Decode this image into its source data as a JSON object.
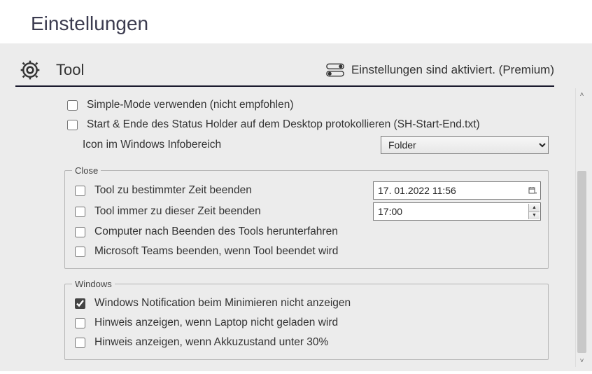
{
  "page_title": "Einstellungen",
  "section": "Tool",
  "premium_status": "Einstellungen sind aktiviert. (Premium)",
  "top": {
    "simple_mode": {
      "label": "Simple-Mode verwenden (nicht empfohlen)",
      "checked": false
    },
    "protocol": {
      "label": "Start & Ende des Status Holder auf dem Desktop protokollieren (SH-Start-End.txt)",
      "checked": false
    },
    "tray_icon": {
      "label": "Icon im Windows Infobereich",
      "value": "Folder",
      "options": [
        "Folder"
      ]
    }
  },
  "close": {
    "legend": "Close",
    "end_at_time": {
      "label": "Tool zu bestimmter Zeit beenden",
      "checked": false,
      "datetime": "17. 01.2022   11:56"
    },
    "end_always": {
      "label": "Tool immer zu dieser Zeit beenden",
      "checked": false,
      "time": "17:00"
    },
    "shutdown": {
      "label": "Computer nach Beenden des Tools herunterfahren",
      "checked": false
    },
    "quit_teams": {
      "label": "Microsoft Teams beenden, wenn Tool beendet wird",
      "checked": false
    }
  },
  "windows": {
    "legend": "Windows",
    "no_min_notif": {
      "label": "Windows Notification beim Minimieren nicht anzeigen",
      "checked": true
    },
    "laptop_charge": {
      "label": "Hinweis anzeigen, wenn Laptop nicht geladen wird",
      "checked": false
    },
    "battery_30": {
      "label": "Hinweis anzeigen, wenn Akkuzustand unter 30%",
      "checked": false
    }
  }
}
